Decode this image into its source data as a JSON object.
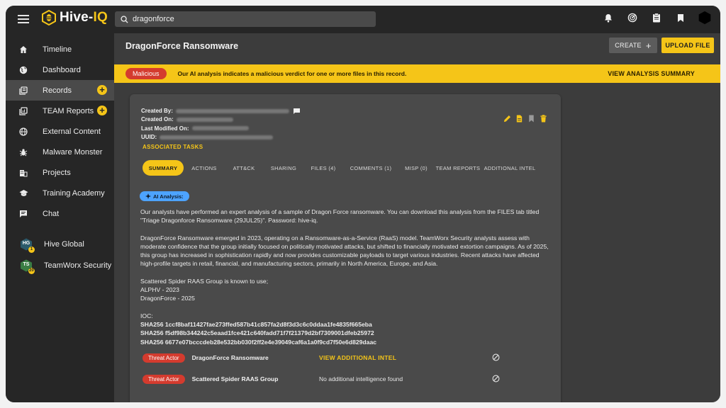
{
  "app": {
    "logo_text_a": "Hive-",
    "logo_text_b": "IQ"
  },
  "search": {
    "value": "dragonforce"
  },
  "top_icons": [
    "bell-icon",
    "radar-icon",
    "clipboard-icon",
    "bookmark-icon",
    "user-avatar-icon"
  ],
  "sidebar": {
    "items": [
      {
        "label": "Timeline",
        "icon": "home-icon"
      },
      {
        "label": "Dashboard",
        "icon": "globe-icon"
      },
      {
        "label": "Records",
        "icon": "records-icon",
        "active": true,
        "plus": true
      },
      {
        "label": "TEAM Reports",
        "icon": "reports-icon",
        "plus": true
      },
      {
        "label": "External Content",
        "icon": "web-icon"
      },
      {
        "label": "Malware Monster",
        "icon": "bug-icon"
      },
      {
        "label": "Projects",
        "icon": "building-icon"
      },
      {
        "label": "Training Academy",
        "icon": "graduation-cap-icon"
      },
      {
        "label": "Chat",
        "icon": "chat-icon"
      }
    ],
    "groups": [
      {
        "label": "Hive Global",
        "badge": "HG",
        "badge_color": "#2c5a6b",
        "dot": "1"
      },
      {
        "label": "TeamWorx Security",
        "badge": "TS",
        "badge_color": "#3a7d44",
        "dot": "20"
      }
    ]
  },
  "main": {
    "title": "DragonForce Ransomware",
    "create_label": "CREATE",
    "create_plus": "+",
    "upload_label": "UPLOAD FILE"
  },
  "banner": {
    "pill": "Malicious",
    "message": "Our AI analysis indicates a malicious verdict for one or more files in this record.",
    "link": "VIEW ANALYSIS SUMMARY"
  },
  "card": {
    "meta": {
      "created_by_label": "Created By:",
      "created_on_label": "Created On:",
      "last_modified_label": "Last Modified On:",
      "uuid_label": "UUID:"
    },
    "associated_tasks": "ASSOCIATED TASKS",
    "tabs": [
      "SUMMARY",
      "ACTIONS",
      "ATT&CK",
      "SHARING",
      "FILES (4)",
      "COMMENTS (1)",
      "MISP (0)",
      "TEAM REPORTS",
      "ADDITIONAL INTEL"
    ],
    "ai_label": "AI Analysis:",
    "paragraphs": [
      "Our analysts have performed an expert analysis of a sample of Dragon Force ransomware. You can download this analysis from the FILES tab titled \"Triage Dragonforce Ransomware (29JUL25)\". Password: hive-iq.",
      "DragonForce Ransomware emerged in 2023, operating on a Ransomware-as-a-Service (RaaS) model. TeamWorx Security analysts assess with moderate confidence that the group initially focused on politically motivated attacks, but shifted to financially motivated extortion campaigns. As of 2025, this group has increased in sophistication rapidly and now provides customizable payloads to target various industries. Recent attacks have affected high-profile targets in retail, financial, and manufacturing sectors, primarily in North America, Europe, and Asia."
    ],
    "scattered": {
      "line1": "Scattered Spider RAAS Group is known to use;",
      "line2": "ALPHV - 2023",
      "line3": "DragonForce - 2025"
    },
    "ioc": {
      "label": "IOC:",
      "hashes": [
        "SHA256 1ccf8baf11427fae273ffed587b41c857fa2d8f3d3c6c0ddaa1fe4835f665eba",
        "SHA256 f5df98b344242c5eaad1fce421c640fadd71f7f21379d2bf7309001dfeb25972",
        "SHA256 6677e07bcccdeb28e532bb030f2ff2e4e39049caf6a1a0f9cd7f50e6d829daac"
      ]
    },
    "intel_rows": [
      {
        "pill": "Threat Actor",
        "name": "DragonForce Ransomware",
        "info": "VIEW ADDITIONAL INTEL",
        "info_is_link": true
      },
      {
        "pill": "Threat Actor",
        "name": "Scattered Spider RAAS Group",
        "info": "No additional intelligence found",
        "info_is_link": false
      }
    ]
  },
  "colors": {
    "accent": "#f5c518",
    "danger": "#d43b2e",
    "ai": "#4da3ff",
    "bg": "#3c3c3c",
    "sidebar": "#262626"
  }
}
